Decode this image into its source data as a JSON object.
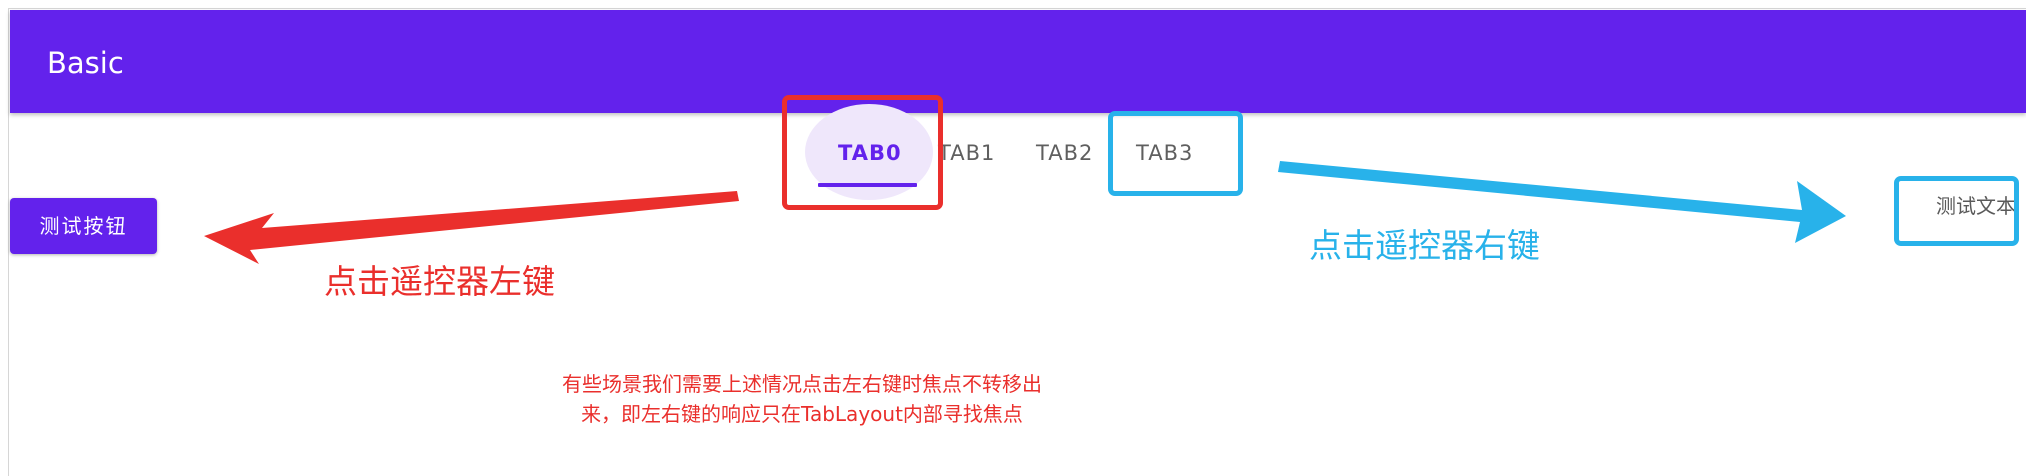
{
  "appbar": {
    "title": "Basic"
  },
  "tabs": [
    {
      "label": "TAB0",
      "selected": true
    },
    {
      "label": "TAB1",
      "selected": false
    },
    {
      "label": "TAB2",
      "selected": false
    },
    {
      "label": "TAB3",
      "selected": false
    }
  ],
  "content": {
    "button_label": "测试按钮",
    "text_label": "测试文本"
  },
  "annotations": {
    "left_key": "点击遥控器左键",
    "right_key": "点击遥控器右键",
    "note_line1": "有些场景我们需要上述情况点击左右键时焦点不转移出",
    "note_line2": "来，即左右键的响应只在TabLayout内部寻找焦点"
  },
  "colors": {
    "primary": "#6322ec",
    "annotation_red": "#ea2f2c",
    "annotation_blue": "#28b2ea"
  }
}
